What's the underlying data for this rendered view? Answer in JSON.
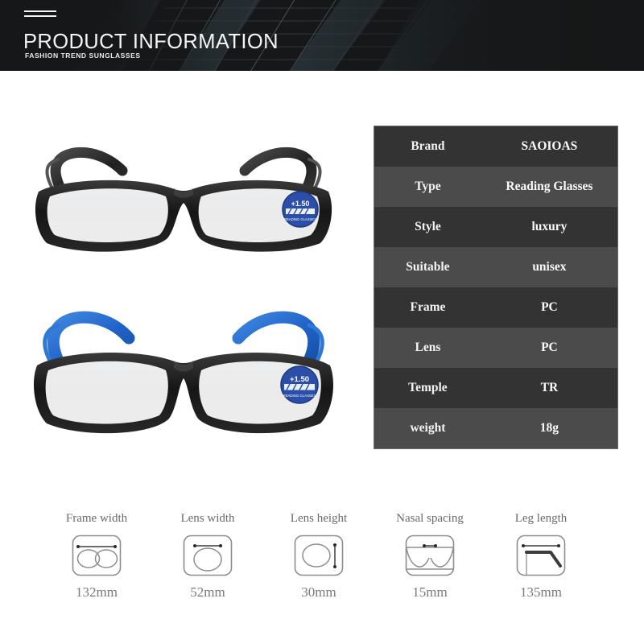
{
  "banner": {
    "title": "PRODUCT INFORMATION",
    "subtitle": "FASHION TREND SUNGLASSES",
    "background_color": "#161718",
    "text_color": "#f4f4f4"
  },
  "products": [
    {
      "name": "black-reading-glasses",
      "frame_color": "#1b1b1b",
      "temple_color": "#2a2a2a",
      "sticker_text": "+1.50",
      "sticker_color": "#2b4fa8"
    },
    {
      "name": "blue-temple-reading-glasses",
      "frame_color": "#1b1b1b",
      "temple_color": "#1f63c8",
      "sticker_text": "+1.50",
      "sticker_color": "#2b4fa8"
    }
  ],
  "spec_table": {
    "row_color_odd": "#333334",
    "row_color_even": "#4b4b4c",
    "rows": [
      {
        "key": "Brand",
        "value": "SAOIOAS"
      },
      {
        "key": "Type",
        "value": "Reading Glasses"
      },
      {
        "key": "Style",
        "value": "luxury"
      },
      {
        "key": "Suitable",
        "value": "unisex"
      },
      {
        "key": "Frame",
        "value": "PC"
      },
      {
        "key": "Lens",
        "value": "PC"
      },
      {
        "key": "Temple",
        "value": "TR"
      },
      {
        "key": "weight",
        "value": "18g"
      }
    ]
  },
  "measurements": [
    {
      "label": "Frame width",
      "value": "132mm",
      "icon": "frame-width-icon"
    },
    {
      "label": "Lens width",
      "value": "52mm",
      "icon": "lens-width-icon"
    },
    {
      "label": "Lens height",
      "value": "30mm",
      "icon": "lens-height-icon"
    },
    {
      "label": "Nasal spacing",
      "value": "15mm",
      "icon": "nasal-spacing-icon"
    },
    {
      "label": "Leg length",
      "value": "135mm",
      "icon": "leg-length-icon"
    }
  ]
}
